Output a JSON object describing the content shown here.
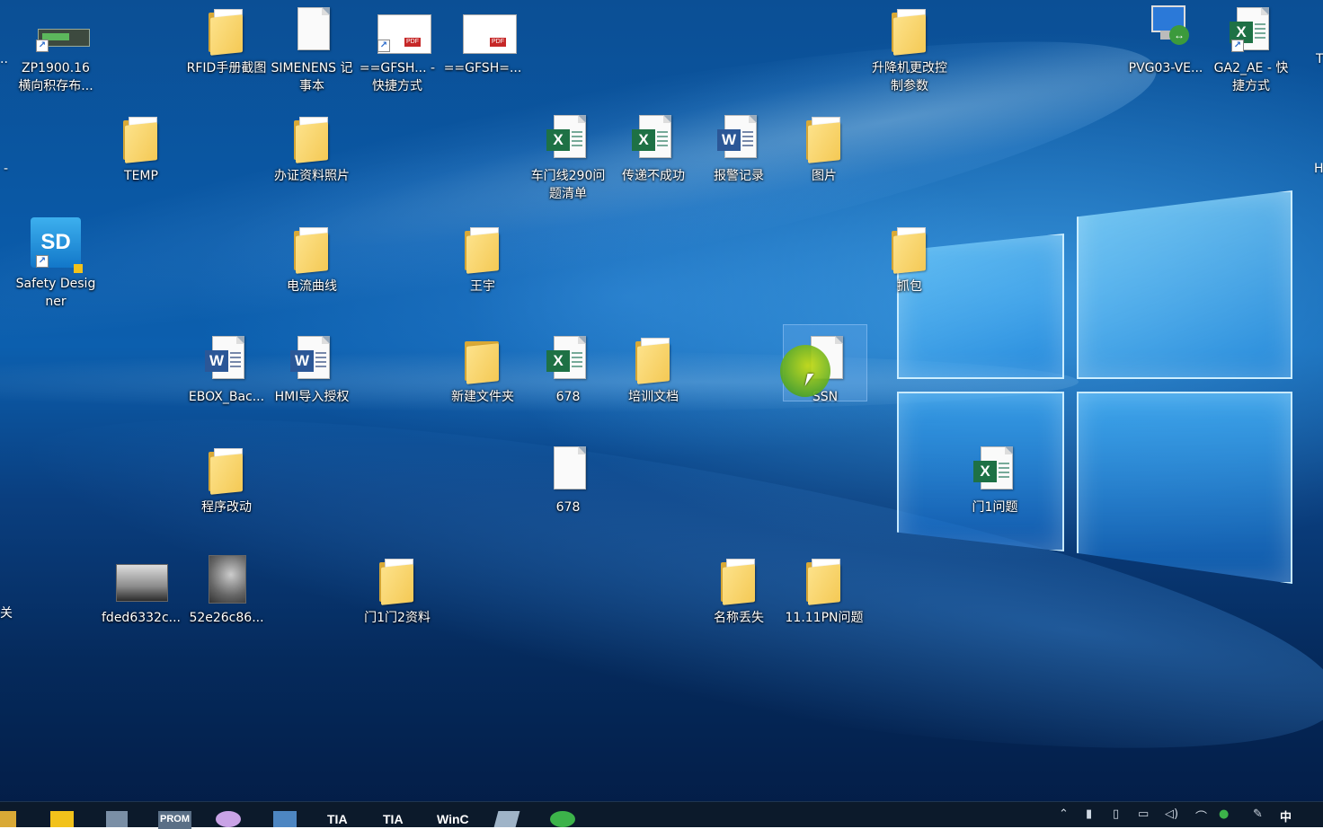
{
  "desktop": {
    "icons": [
      {
        "id": "zp1900",
        "label": "ZP1900.16 横向积存布...",
        "type": "program"
      },
      {
        "id": "rfid",
        "label": "RFID手册截图",
        "type": "folder"
      },
      {
        "id": "simenens",
        "label": "SIMENENS 记事本",
        "type": "text"
      },
      {
        "id": "gfsh1",
        "label": "==GFSH... - 快捷方式",
        "type": "pdf-shortcut"
      },
      {
        "id": "gfsh2",
        "label": "==GFSH=...",
        "type": "pdf"
      },
      {
        "id": "shengjiang",
        "label": "升降机更改控制参数",
        "type": "folder"
      },
      {
        "id": "pvg03",
        "label": "PVG03-VE...",
        "type": "remote-desktop"
      },
      {
        "id": "ga2ae",
        "label": "GA2_AE - 快捷方式",
        "type": "excel-shortcut"
      },
      {
        "id": "temp",
        "label": "TEMP",
        "type": "folder"
      },
      {
        "id": "banzheng",
        "label": "办证资料照片",
        "type": "folder"
      },
      {
        "id": "chemen",
        "label": "车门线290问题清单",
        "type": "excel"
      },
      {
        "id": "chuandi",
        "label": "传递不成功",
        "type": "excel"
      },
      {
        "id": "baojing",
        "label": "报警记录",
        "type": "word"
      },
      {
        "id": "tupian",
        "label": "图片",
        "type": "folder"
      },
      {
        "id": "safety",
        "label": "Safety Designer",
        "type": "app-shortcut"
      },
      {
        "id": "dianliu",
        "label": "电流曲线",
        "type": "folder"
      },
      {
        "id": "wangyu",
        "label": "王宇",
        "type": "folder"
      },
      {
        "id": "zhuabao",
        "label": "抓包",
        "type": "folder"
      },
      {
        "id": "ebox",
        "label": "EBOX_Bac...",
        "type": "word"
      },
      {
        "id": "hmi",
        "label": "HMI导入授权",
        "type": "word"
      },
      {
        "id": "xinjian",
        "label": "新建文件夹",
        "type": "folder"
      },
      {
        "id": "excel678",
        "label": "678",
        "type": "excel"
      },
      {
        "id": "peixun",
        "label": "培训文档",
        "type": "folder"
      },
      {
        "id": "ssn",
        "label": "SSN",
        "type": "text"
      },
      {
        "id": "chengxu",
        "label": "程序改动",
        "type": "folder"
      },
      {
        "id": "text678",
        "label": "678",
        "type": "text"
      },
      {
        "id": "men1",
        "label": "门1问题",
        "type": "excel"
      },
      {
        "id": "fded",
        "label": "fded6332c...",
        "type": "image"
      },
      {
        "id": "img52e",
        "label": "52e26c86...",
        "type": "image"
      },
      {
        "id": "men1men2",
        "label": "门1门2资料",
        "type": "folder"
      },
      {
        "id": "mingcheng",
        "label": "名称丢失",
        "type": "folder"
      },
      {
        "id": "pn",
        "label": "11.11PN问题",
        "type": "folder"
      }
    ],
    "edge_fragments": {
      "left_top": "..",
      "left_mid": "-",
      "left_bottom": "关",
      "right_top": "T",
      "right_mid": "H"
    }
  },
  "taskbar": {
    "items": [
      "PROM",
      "TIA",
      "TIA",
      "WinC"
    ],
    "tray_ime": "中"
  },
  "colors": {
    "excel": "#1e7145",
    "word": "#2b5797",
    "folder": "#f4c955",
    "taskbar": "#0c1a2b"
  }
}
